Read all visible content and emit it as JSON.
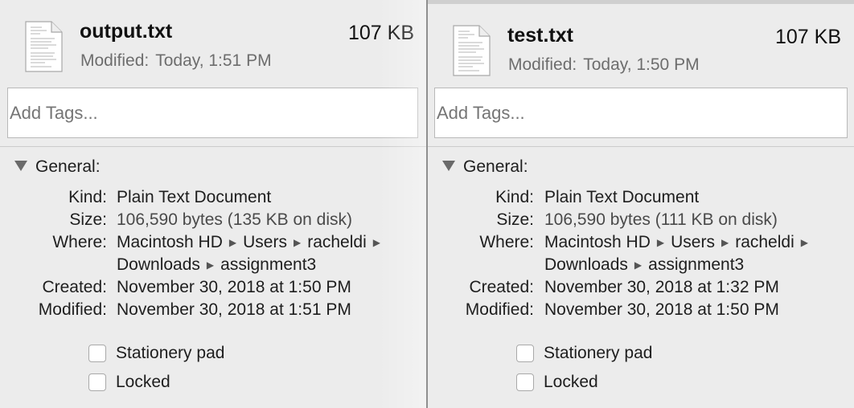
{
  "panels": [
    {
      "file_name": "output.txt",
      "file_size": "107 KB",
      "modified_label": "Modified:",
      "modified_value": "Today, 1:51 PM",
      "tags_placeholder": "Add Tags...",
      "section_title": "General:",
      "kind_label": "Kind:",
      "kind_value": "Plain Text Document",
      "size_label": "Size:",
      "size_value": "106,590 bytes (135 KB on disk)",
      "where_label": "Where:",
      "where_path": [
        "Macintosh HD",
        "Users",
        "racheldi",
        "Downloads",
        "assignment3"
      ],
      "created_label": "Created:",
      "created_value": "November 30, 2018 at 1:50 PM",
      "modified_full_label": "Modified:",
      "modified_full_value": "November 30, 2018 at 1:51 PM",
      "stationery_label": "Stationery pad",
      "locked_label": "Locked"
    },
    {
      "file_name": "test.txt",
      "file_size": "107 KB",
      "modified_label": "Modified:",
      "modified_value": "Today, 1:50 PM",
      "tags_placeholder": "Add Tags...",
      "section_title": "General:",
      "kind_label": "Kind:",
      "kind_value": "Plain Text Document",
      "size_label": "Size:",
      "size_value": "106,590 bytes (111 KB on disk)",
      "where_label": "Where:",
      "where_path": [
        "Macintosh HD",
        "Users",
        "racheldi",
        "Downloads",
        "assignment3"
      ],
      "created_label": "Created:",
      "created_value": "November 30, 2018 at 1:32 PM",
      "modified_full_label": "Modified:",
      "modified_full_value": "November 30, 2018 at 1:50 PM",
      "stationery_label": "Stationery pad",
      "locked_label": "Locked"
    }
  ],
  "icons": {
    "file": "text-document-icon",
    "disclosure": "disclosure-triangle-icon",
    "path_separator": "path-arrow-icon"
  },
  "colors": {
    "background": "#ececec",
    "secondary_text": "#6d6d6d",
    "placeholder": "#bcbcbc"
  }
}
